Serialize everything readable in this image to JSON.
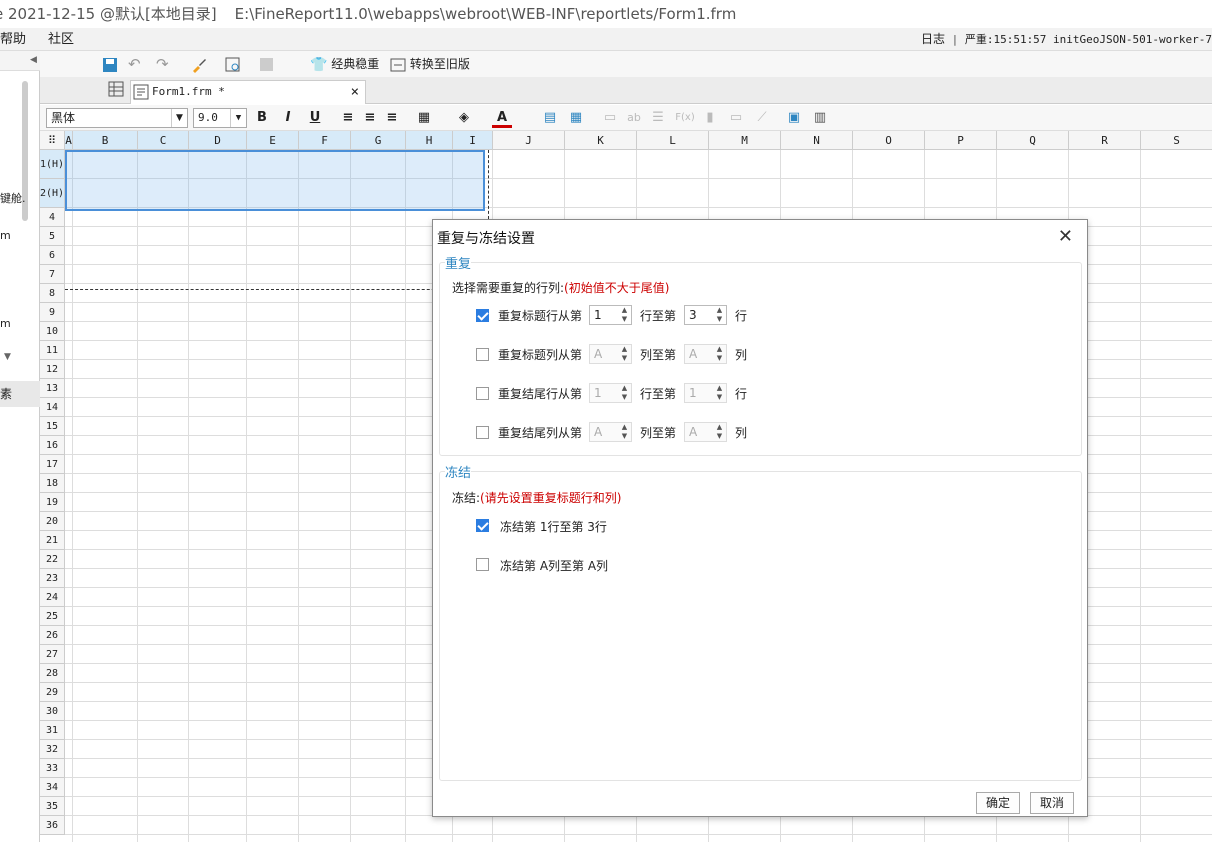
{
  "window": {
    "title_prefix": "e 2021-12-15 @默认[本地目录]",
    "title_path": "E:\\FineReport11.0\\webapps\\webroot\\WEB-INF\\reportlets/Form1.frm"
  },
  "menu": {
    "items": [
      "帮助",
      "社区"
    ],
    "log_label": "日志",
    "log_text": "严重:15:51:57 initGeoJSON-501-worker-7"
  },
  "left_panel": {
    "fragment1": "键舱.",
    "fragment2": "m",
    "fragment3": "m",
    "section_label": "素"
  },
  "toolbar": {
    "stable_label": "经典稳重",
    "convert_label": "转换至旧版"
  },
  "tab": {
    "name": "Form1.frm *",
    "close": "×"
  },
  "format_bar": {
    "font_name": "黑体",
    "font_size": "9.0",
    "bold": "B",
    "italic": "I",
    "underline": "U",
    "fx": "F(x)",
    "ab": "ab"
  },
  "sheet": {
    "columns": [
      "A",
      "B",
      "C",
      "D",
      "E",
      "F",
      "G",
      "H",
      "I",
      "J",
      "K",
      "L",
      "M",
      "N",
      "O",
      "P",
      "Q",
      "R",
      "S"
    ],
    "rows": [
      "1(H)",
      "2(H)",
      "4",
      "5",
      "6",
      "7",
      "8",
      "9",
      "10",
      "11",
      "12",
      "13",
      "14",
      "15",
      "16",
      "17",
      "18",
      "19",
      "20",
      "21",
      "22",
      "23",
      "24",
      "25",
      "26",
      "27",
      "28",
      "29",
      "30",
      "31",
      "32",
      "33",
      "34",
      "35",
      "36"
    ]
  },
  "dialog": {
    "title": "重复与冻结设置",
    "close": "✕",
    "repeat_group": "重复",
    "repeat_prompt": "选择需要重复的行列:",
    "repeat_hint": "(初始值不大于尾值)",
    "rows": [
      {
        "label": "重复标题行从第",
        "checked": true,
        "from": "1",
        "mid": "行至第",
        "to": "3",
        "suffix": "行",
        "enabled": true
      },
      {
        "label": "重复标题列从第",
        "checked": false,
        "from": "A",
        "mid": "列至第",
        "to": "A",
        "suffix": "列",
        "enabled": false
      },
      {
        "label": "重复结尾行从第",
        "checked": false,
        "from": "1",
        "mid": "行至第",
        "to": "1",
        "suffix": "行",
        "enabled": false
      },
      {
        "label": "重复结尾列从第",
        "checked": false,
        "from": "A",
        "mid": "列至第",
        "to": "A",
        "suffix": "列",
        "enabled": false
      }
    ],
    "freeze_group": "冻结",
    "freeze_prompt": "冻结:",
    "freeze_hint": "(请先设置重复标题行和列)",
    "freeze_rows_label": "冻结第 1行至第 3行",
    "freeze_rows_checked": true,
    "freeze_cols_label": "冻结第 A列至第 A列",
    "freeze_cols_checked": false,
    "ok": "确定",
    "cancel": "取消"
  },
  "colors": {
    "accent": "#2b7de1",
    "group_title": "#2e86c1",
    "hint_red": "#cc0000",
    "selection": "#4a8fd8"
  }
}
